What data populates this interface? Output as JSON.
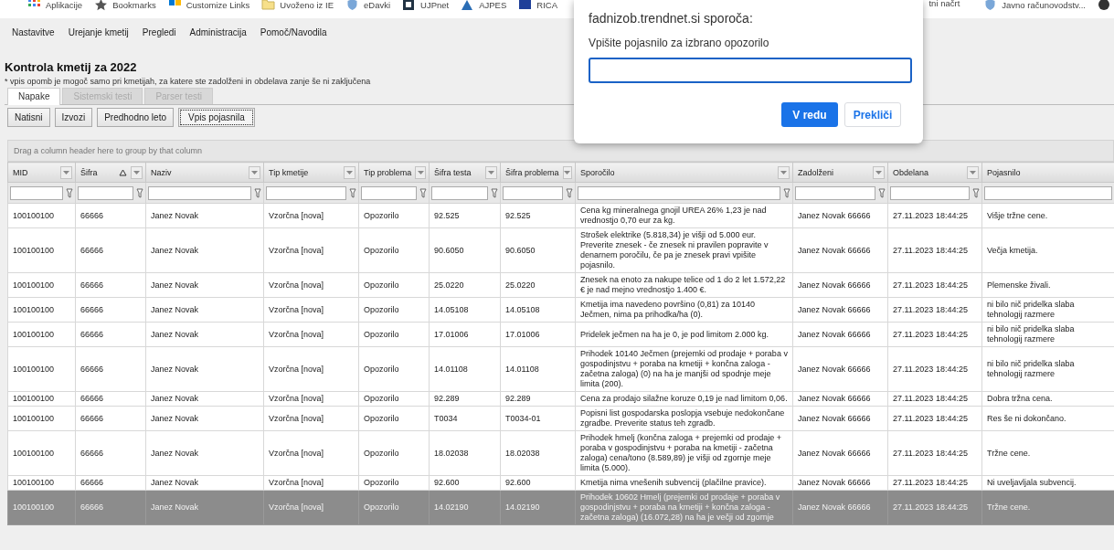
{
  "bookmarks": {
    "left": [
      {
        "label": "Aplikacije"
      },
      {
        "label": "Bookmarks"
      },
      {
        "label": "Customize Links"
      },
      {
        "label": "Uvoženo iz IE"
      },
      {
        "label": "eDavki"
      },
      {
        "label": "UJPnet"
      },
      {
        "label": "AJPES"
      },
      {
        "label": "RICA"
      }
    ],
    "right": [
      {
        "label": "tni načrt"
      },
      {
        "label": "Javno računovodstv..."
      }
    ]
  },
  "menu": [
    "Nastavitve",
    "Urejanje kmetij",
    "Pregledi",
    "Administracija",
    "Pomoč/Navodila"
  ],
  "page": {
    "title": "Kontrola kmetij za 2022",
    "note": "* vpis opomb je mogoč samo pri kmetijah, za katere ste zadolženi in obdelava zanje še ni zaključena"
  },
  "tabs": [
    {
      "label": "Napake",
      "selected": true,
      "disabled": false
    },
    {
      "label": "Sistemski testi",
      "selected": false,
      "disabled": true
    },
    {
      "label": "Parser testi",
      "selected": false,
      "disabled": true
    }
  ],
  "toolbar": [
    {
      "label": "Natisni",
      "focused": false
    },
    {
      "label": "Izvozi",
      "focused": false
    },
    {
      "label": "Predhodno leto",
      "focused": false
    },
    {
      "label": "Vpis pojasnila",
      "focused": true
    }
  ],
  "grid": {
    "group_hint": "Drag a column header here to group by that column",
    "columns": [
      {
        "label": "MID",
        "sorted": false,
        "menu": true,
        "filter": true
      },
      {
        "label": "Šifra",
        "sorted": true,
        "menu": true,
        "filter": true
      },
      {
        "label": "Naziv",
        "sorted": false,
        "menu": true,
        "filter": true
      },
      {
        "label": "Tip kmetije",
        "sorted": false,
        "menu": true,
        "filter": true
      },
      {
        "label": "Tip problema",
        "sorted": false,
        "menu": true,
        "filter": true
      },
      {
        "label": "Šifra testa",
        "sorted": false,
        "menu": true,
        "filter": true
      },
      {
        "label": "Šifra problema",
        "sorted": false,
        "menu": true,
        "filter": true
      },
      {
        "label": "Sporočilo",
        "sorted": false,
        "menu": true,
        "filter": true
      },
      {
        "label": "Zadolženi",
        "sorted": false,
        "menu": true,
        "filter": true
      },
      {
        "label": "Obdelana",
        "sorted": false,
        "menu": true,
        "filter": true
      },
      {
        "label": "Pojasnilo",
        "sorted": false,
        "menu": false,
        "filter": false
      }
    ],
    "rows": [
      {
        "selected": false,
        "cells": [
          "100100100",
          "66666",
          "Janez Novak",
          "Vzorčna [nova]",
          "Opozorilo",
          "92.525",
          "92.525",
          "Cena kg mineralnega gnojil UREA 26% 1,23 je nad vrednostjo 0,70 eur za kg.",
          "Janez Novak 66666",
          "27.11.2023 18:44:25",
          "Višje tržne cene."
        ]
      },
      {
        "selected": false,
        "cells": [
          "100100100",
          "66666",
          "Janez Novak",
          "Vzorčna [nova]",
          "Opozorilo",
          "90.6050",
          "90.6050",
          "Strošek elektrike (5.818,34) je višji od 5.000 eur. Preverite znesek - če znesek ni pravilen popravite v denarnem poročilu, če pa je znesek pravi vpišite pojasnilo.",
          "Janez Novak 66666",
          "27.11.2023 18:44:25",
          "Večja kmetija."
        ]
      },
      {
        "selected": false,
        "cells": [
          "100100100",
          "66666",
          "Janez Novak",
          "Vzorčna [nova]",
          "Opozorilo",
          "25.0220",
          "25.0220",
          "Znesek na enoto za nakupe telice od 1 do 2 let 1.572,22 € je nad mejno vrednostjo 1.400 €.",
          "Janez Novak 66666",
          "27.11.2023 18:44:25",
          "Plemenske živali."
        ]
      },
      {
        "selected": false,
        "cells": [
          "100100100",
          "66666",
          "Janez Novak",
          "Vzorčna [nova]",
          "Opozorilo",
          "14.05108",
          "14.05108",
          "Kmetija ima navedeno površino (0,81) za 10140 Ječmen, nima pa prihodka/ha (0).",
          "Janez Novak 66666",
          "27.11.2023 18:44:25",
          "ni bilo nič pridelka slaba tehnologij razmere"
        ]
      },
      {
        "selected": false,
        "cells": [
          "100100100",
          "66666",
          "Janez Novak",
          "Vzorčna [nova]",
          "Opozorilo",
          "17.01006",
          "17.01006",
          "Pridelek ječmen na ha je 0, je pod limitom 2.000 kg.",
          "Janez Novak 66666",
          "27.11.2023 18:44:25",
          "ni bilo nič pridelka slaba tehnologij razmere"
        ]
      },
      {
        "selected": false,
        "cells": [
          "100100100",
          "66666",
          "Janez Novak",
          "Vzorčna [nova]",
          "Opozorilo",
          "14.01108",
          "14.01108",
          "Prihodek 10140 Ječmen (prejemki od prodaje + poraba v gospodinjstvu + poraba na kmetiji + končna zaloga - začetna zaloga) (0) na ha je manjši od spodnje meje limita (200).",
          "Janez Novak 66666",
          "27.11.2023 18:44:25",
          "ni bilo nič pridelka slaba tehnologij razmere"
        ]
      },
      {
        "selected": false,
        "cells": [
          "100100100",
          "66666",
          "Janez Novak",
          "Vzorčna [nova]",
          "Opozorilo",
          "92.289",
          "92.289",
          "Cena za prodajo silažne koruze 0,19 je nad limitom 0,06.",
          "Janez Novak 66666",
          "27.11.2023 18:44:25",
          "Dobra tržna cena."
        ]
      },
      {
        "selected": false,
        "cells": [
          "100100100",
          "66666",
          "Janez Novak",
          "Vzorčna [nova]",
          "Opozorilo",
          "T0034",
          "T0034-01",
          "Popisni list gospodarska poslopja vsebuje nedokončane zgradbe. Preverite status teh zgradb.",
          "Janez Novak 66666",
          "27.11.2023 18:44:25",
          "Res še ni dokončano."
        ]
      },
      {
        "selected": false,
        "cells": [
          "100100100",
          "66666",
          "Janez Novak",
          "Vzorčna [nova]",
          "Opozorilo",
          "18.02038",
          "18.02038",
          "Prihodek hmelj (končna zaloga + prejemki od prodaje + poraba v gospodinjstvu + poraba na kmetiji - začetna zaloga) cena/tono (8.589,89) je višji od zgornje meje limita (5.000).",
          "Janez Novak 66666",
          "27.11.2023 18:44:25",
          "Tržne cene."
        ]
      },
      {
        "selected": false,
        "cells": [
          "100100100",
          "66666",
          "Janez Novak",
          "Vzorčna [nova]",
          "Opozorilo",
          "92.600",
          "92.600",
          "Kmetija nima vnešenih subvencij (plačilne pravice).",
          "Janez Novak 66666",
          "27.11.2023 18:44:25",
          "Ni uveljavljala subvencij."
        ]
      },
      {
        "selected": true,
        "cells": [
          "100100100",
          "66666",
          "Janez Novak",
          "Vzorčna [nova]",
          "Opozorilo",
          "14.02190",
          "14.02190",
          "Prihodek 10602 Hmelj (prejemki od prodaje + poraba v gospodinjstvu + poraba na kmetiji + končna zaloga - začetna zaloga) (16.072,28) na ha je večji od zgornje",
          "Janez Novak 66666",
          "27.11.2023 18:44:25",
          "Tržne cene."
        ]
      }
    ]
  },
  "dialog": {
    "title": "fadnizob.trendnet.si sporoča:",
    "message": "Vpišite pojasnilo za izbrano opozorilo",
    "buttons": [
      {
        "label": "V redu",
        "kind": "primary"
      },
      {
        "label": "Prekliči",
        "kind": "secondary"
      }
    ]
  }
}
